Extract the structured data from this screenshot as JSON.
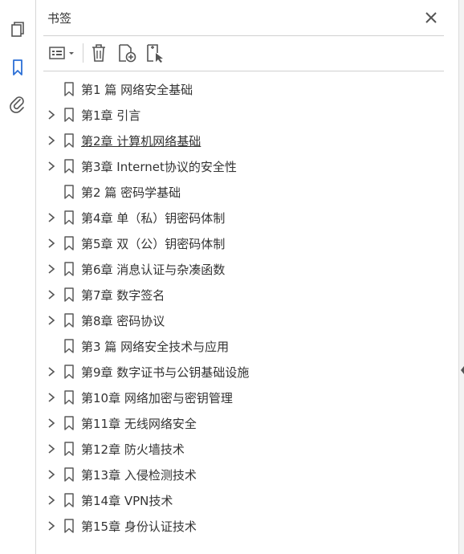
{
  "panel": {
    "title": "书签"
  },
  "rail": {
    "items": [
      {
        "icon": "pages-icon"
      },
      {
        "icon": "bookmark-icon"
      },
      {
        "icon": "paperclip-icon"
      }
    ]
  },
  "toolbar": {
    "buttons": [
      "options-menu-icon",
      "delete-icon",
      "new-bookmark-icon",
      "new-bookmark-from-selection-icon"
    ]
  },
  "bookmarks": [
    {
      "label": "第1 篇 网络安全基础",
      "expandable": false
    },
    {
      "label": "第1章 引言",
      "expandable": true
    },
    {
      "label": "第2章 计算机网络基础",
      "expandable": true,
      "hovered": true
    },
    {
      "label": "第3章 Internet协议的安全性",
      "expandable": true
    },
    {
      "label": "第2 篇 密码学基础",
      "expandable": false
    },
    {
      "label": "第4章 单（私）钥密码体制",
      "expandable": true
    },
    {
      "label": "第5章 双（公）钥密码体制",
      "expandable": true
    },
    {
      "label": "第6章 消息认证与杂凑函数",
      "expandable": true
    },
    {
      "label": "第7章 数字签名",
      "expandable": true
    },
    {
      "label": "第8章 密码协议",
      "expandable": true
    },
    {
      "label": "第3 篇 网络安全技术与应用",
      "expandable": false
    },
    {
      "label": "第9章 数字证书与公钥基础设施",
      "expandable": true
    },
    {
      "label": "第10章 网络加密与密钥管理",
      "expandable": true
    },
    {
      "label": "第11章 无线网络安全",
      "expandable": true
    },
    {
      "label": "第12章 防火墙技术",
      "expandable": true
    },
    {
      "label": "第13章 入侵检测技术",
      "expandable": true
    },
    {
      "label": "第14章 VPN技术",
      "expandable": true
    },
    {
      "label": "第15章 身份认证技术",
      "expandable": true
    }
  ],
  "colors": {
    "icon": "#5a5a5a",
    "accent": "#2b6fd6",
    "divider": "#d0d0d0"
  }
}
